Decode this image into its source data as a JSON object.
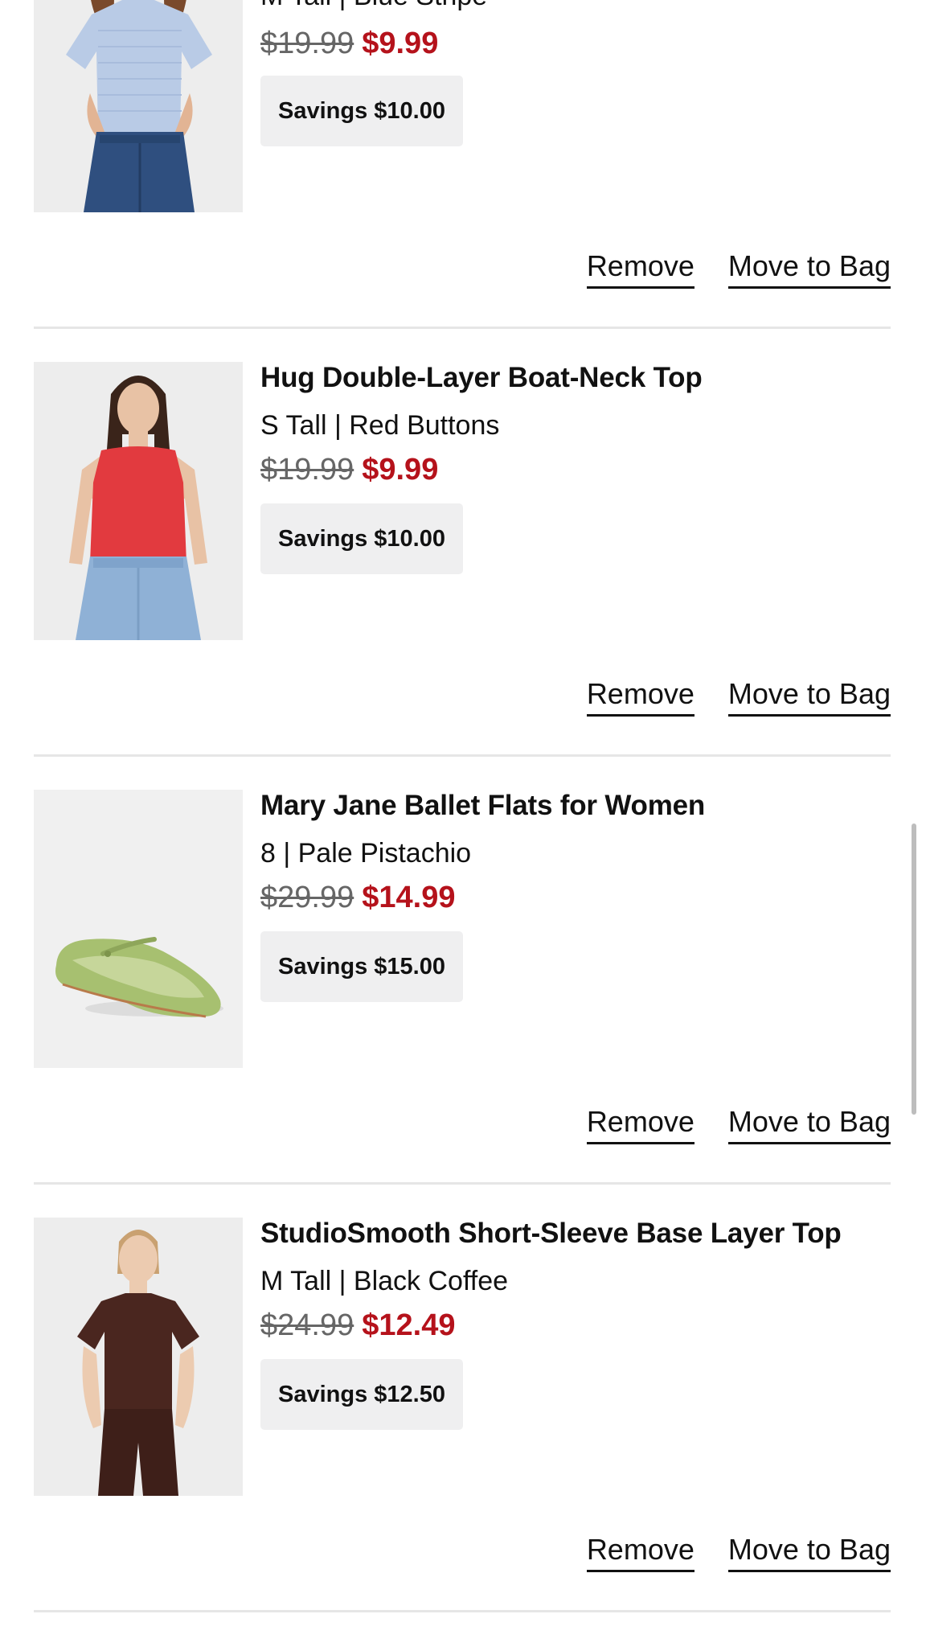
{
  "items": [
    {
      "title": "",
      "variant": "M Tall | Blue Stripe",
      "original_price": "$19.99",
      "sale_price": "$9.99",
      "savings": "Savings $10.00",
      "image_icon": "blue-stripe-tee-photo"
    },
    {
      "title": "Hug Double-Layer Boat-Neck Top",
      "variant": "S Tall | Red Buttons",
      "original_price": "$19.99",
      "sale_price": "$9.99",
      "savings": "Savings $10.00",
      "image_icon": "red-tank-top-photo"
    },
    {
      "title": "Mary Jane Ballet Flats for Women",
      "variant": "8 | Pale Pistachio",
      "original_price": "$29.99",
      "sale_price": "$14.99",
      "savings": "Savings $15.00",
      "image_icon": "green-ballet-flat-photo"
    },
    {
      "title": "StudioSmooth Short-Sleeve Base Layer Top",
      "variant": "M Tall | Black Coffee",
      "original_price": "$24.99",
      "sale_price": "$12.49",
      "savings": "Savings $12.50",
      "image_icon": "brown-base-layer-top-photo"
    }
  ],
  "actions": {
    "remove_label": "Remove",
    "move_label": "Move to Bag"
  },
  "colors": {
    "sale_price": "#b5121b",
    "savings_bg": "#efeff0",
    "divider": "#e6e6e6"
  }
}
